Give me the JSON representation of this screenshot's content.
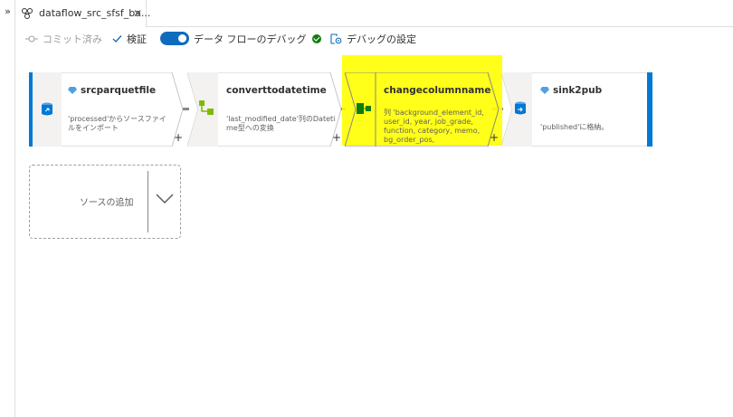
{
  "rail": {
    "expand_glyph": "»"
  },
  "tab": {
    "title": "dataflow_src_sfsf_ba...",
    "icon": "dataflow-icon",
    "close_glyph": "✕"
  },
  "toolbar": {
    "commit_label": "コミット済み",
    "validate_label": "検証",
    "debug_label": "データ フローのデバッグ",
    "debug_settings_label": "デバッグの設定"
  },
  "nodes": [
    {
      "title": "srcparquetfile",
      "icon": "source-icon",
      "desc": [
        "'processed'からソースファイ",
        "ルをインポート"
      ]
    },
    {
      "title": "converttodatetime",
      "icon": "derived-column-icon",
      "desc": [
        "'last_modified_date'列のDateti",
        "me型への変換"
      ]
    },
    {
      "title": "changecolumnname",
      "icon": "select-icon",
      "desc": [
        "列 'background_element_id,",
        "user_id, year, job_grade,",
        "function, category, memo,",
        "bg_order_pos,"
      ]
    },
    {
      "title": "sink2pub",
      "icon": "sink-icon",
      "desc": [
        "'published'に格納。"
      ]
    }
  ],
  "plus_glyph": "+",
  "add_source": {
    "label": "ソースの追加"
  },
  "colors": {
    "accent": "#0f6cbd",
    "node_blue": "#0078d4",
    "highlight": "#ffff00",
    "ok": "#107c10"
  }
}
